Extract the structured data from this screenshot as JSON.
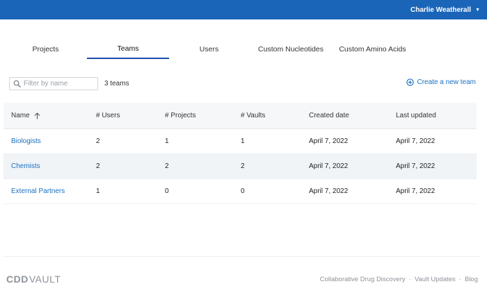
{
  "header": {
    "user_name": "Charlie Weatherall",
    "caret": "▼"
  },
  "tabs": [
    {
      "label": "Projects",
      "active": false
    },
    {
      "label": "Teams",
      "active": true
    },
    {
      "label": "Users",
      "active": false
    },
    {
      "label": "Custom Nucleotides",
      "active": false
    },
    {
      "label": "Custom Amino Acids",
      "active": false
    }
  ],
  "toolbar": {
    "filter_placeholder": "Filter by name",
    "filter_value": "",
    "count_label": "3 teams",
    "create_label": "Create a new team"
  },
  "table": {
    "columns": [
      "Name",
      "# Users",
      "# Projects",
      "# Vaults",
      "Created date",
      "Last updated"
    ],
    "sort_column": "Name",
    "sort_direction": "ascending",
    "rows": [
      {
        "name": "Biologists",
        "users": "2",
        "projects": "1",
        "vaults": "1",
        "created": "April 7, 2022",
        "updated": "April 7, 2022"
      },
      {
        "name": "Chemists",
        "users": "2",
        "projects": "2",
        "vaults": "2",
        "created": "April 7, 2022",
        "updated": "April 7, 2022"
      },
      {
        "name": "External Partners",
        "users": "1",
        "projects": "0",
        "vaults": "0",
        "created": "April 7, 2022",
        "updated": "April 7, 2022"
      }
    ]
  },
  "footer": {
    "logo_cdd": "CDD",
    "logo_vault": "VAULT",
    "links": [
      "Collaborative Drug Discovery",
      "Vault Updates",
      "Blog"
    ],
    "separator": "·"
  },
  "colors": {
    "header_bg": "#1a65b8",
    "link": "#1a6fc0",
    "active_tab_underline": "#1a4ba8",
    "alt_row": "#f0f4f7"
  }
}
